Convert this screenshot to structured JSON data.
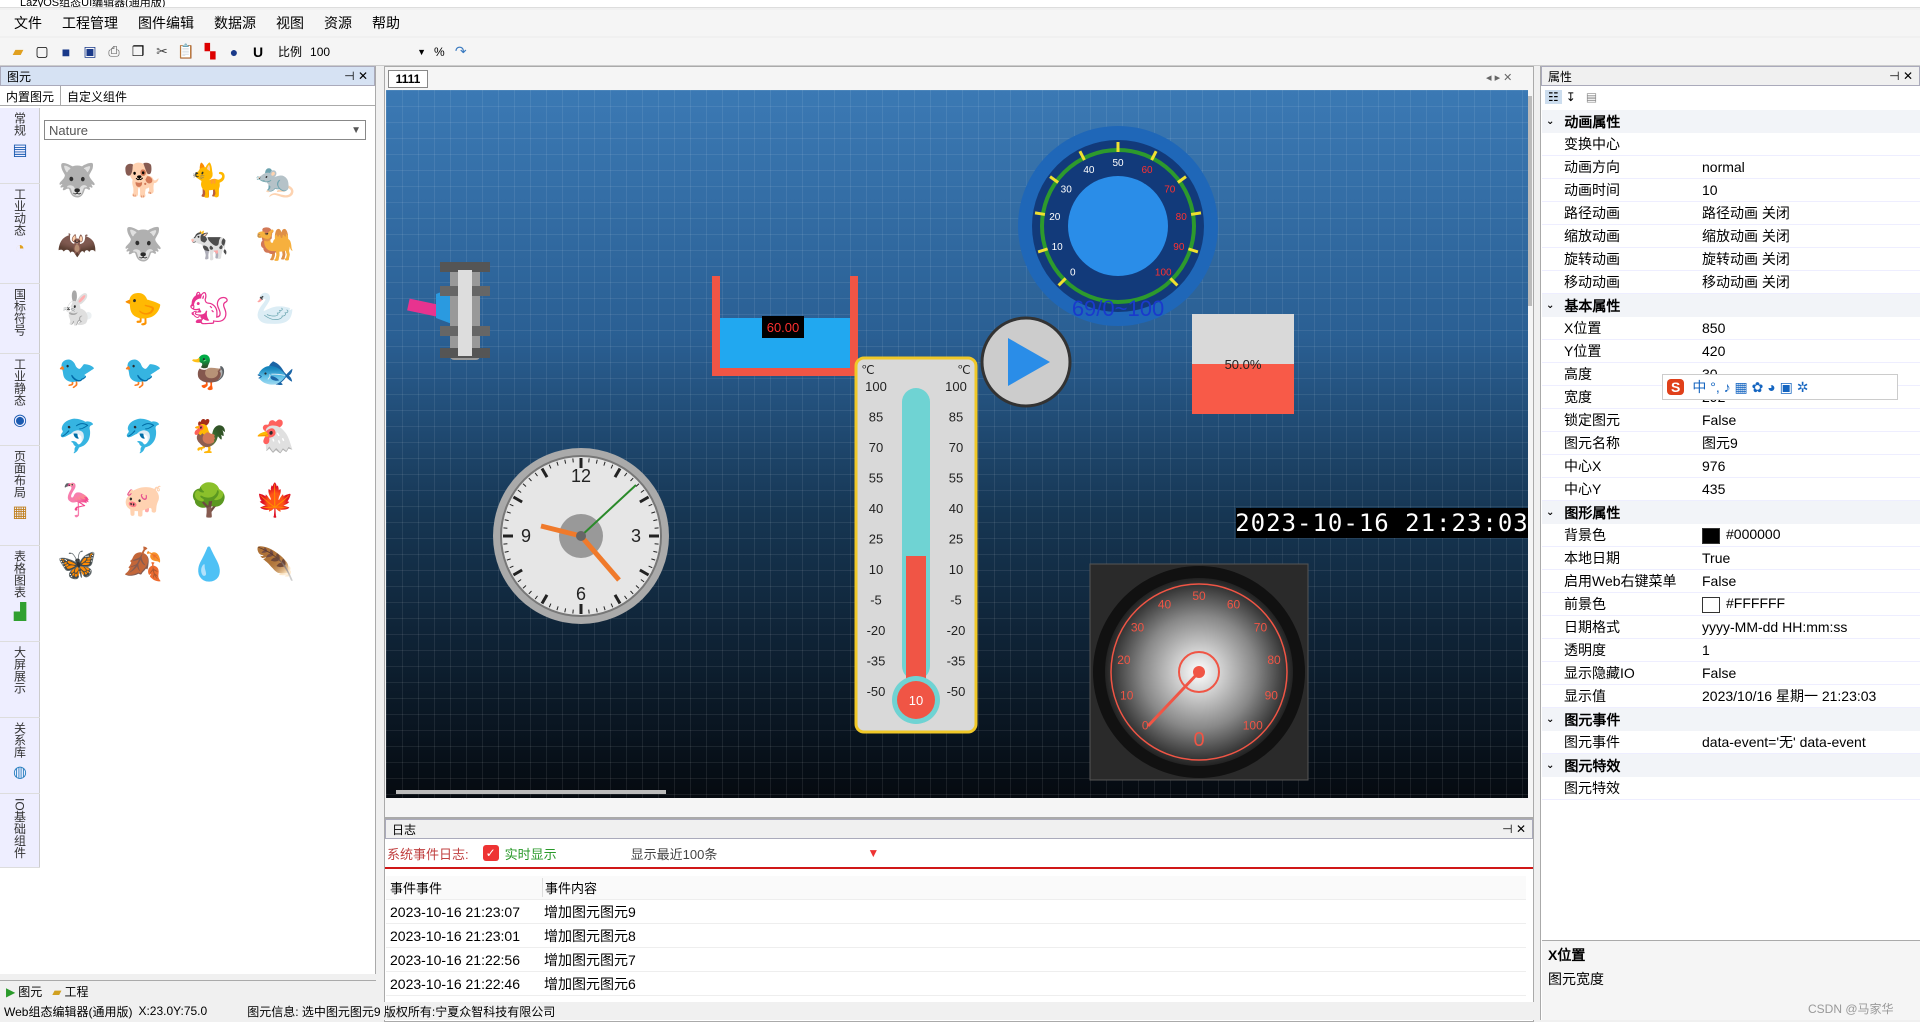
{
  "window": {
    "title": "LazyOS组态UI编辑器(通用版)"
  },
  "menu": [
    "文件",
    "工程管理",
    "图件编辑",
    "数据源",
    "视图",
    "资源",
    "帮助"
  ],
  "toolbar": {
    "scale_label": "比例",
    "scale_value": "100",
    "percent": "%"
  },
  "left_pane": {
    "title": "图元",
    "tabs": [
      "内置图元",
      "自定义组件"
    ],
    "categories": [
      "常规",
      "工业动态",
      "国标符号",
      "工业静态",
      "页面布局",
      "表格图表",
      "大屏展示",
      "关系库",
      "IO基础组件"
    ],
    "library_select": "Nature",
    "bottom_tabs": [
      "图元",
      "工程"
    ]
  },
  "library_icons": [
    "🐺",
    "🐕",
    "🐈",
    "🐀",
    "🦇",
    "🐺",
    "🐄",
    "🐫",
    "🐇",
    "🐤",
    "🐿",
    "🦢",
    "🐦",
    "🐦",
    "🦆",
    "🐟",
    "🐬",
    "🐬",
    "🐓",
    "🐔",
    "🦩",
    "🐖",
    "🌳",
    "🍁",
    "🦋",
    "🍂",
    "💧",
    "🪶"
  ],
  "library_colors": {
    "top": "#e8338f",
    "bottom": "#f07a2b"
  },
  "document": {
    "tab": "1111"
  },
  "canvas": {
    "tank_value": "60.00",
    "gauge_ticks": [
      "0",
      "10",
      "20",
      "30",
      "40",
      "50",
      "60",
      "70",
      "80",
      "90",
      "100"
    ],
    "gauge_readout": "69/0~100",
    "bar_percent": "50.0%",
    "bar_fill": 0.5,
    "thermo_unit": "℃",
    "thermo_scale": [
      "100",
      "85",
      "70",
      "55",
      "40",
      "25",
      "10",
      "-5",
      "-20",
      "-35",
      "-50"
    ],
    "thermo_value": "10",
    "clock_numbers": [
      "12",
      "3",
      "6",
      "9"
    ],
    "datetime": "2023-10-16 21:23:03",
    "speedo_ticks": [
      "0",
      "10",
      "20",
      "30",
      "40",
      "50",
      "60",
      "70",
      "80",
      "90",
      "100"
    ],
    "speedo_value": "0"
  },
  "log_pane": {
    "title": "日志",
    "label": "系统事件日志:",
    "realtime": "实时显示",
    "recent": "显示最近100条",
    "headers": [
      "事件事件",
      "事件内容"
    ],
    "rows": [
      [
        "2023-10-16 21:23:07",
        "增加图元图元9"
      ],
      [
        "2023-10-16 21:23:01",
        "增加图元图元8"
      ],
      [
        "2023-10-16 21:22:56",
        "增加图元图元7"
      ],
      [
        "2023-10-16 21:22:46",
        "增加图元图元6"
      ]
    ]
  },
  "props": {
    "title": "属性",
    "sections": [
      {
        "name": "动画属性",
        "rows": [
          [
            "变换中心",
            ""
          ],
          [
            "动画方向",
            "normal"
          ],
          [
            "动画时间",
            "10"
          ],
          [
            "路径动画",
            "路径动画 关闭"
          ],
          [
            "缩放动画",
            "缩放动画 关闭"
          ],
          [
            "旋转动画",
            "旋转动画 关闭"
          ],
          [
            "移动动画",
            "移动动画 关闭"
          ]
        ]
      },
      {
        "name": "基本属性",
        "rows": [
          [
            "X位置",
            "850"
          ],
          [
            "Y位置",
            "420"
          ],
          [
            "高度",
            "30"
          ],
          [
            "宽度",
            "292"
          ],
          [
            "锁定图元",
            "False"
          ],
          [
            "图元名称",
            "图元9"
          ],
          [
            "中心X",
            "976"
          ],
          [
            "中心Y",
            "435"
          ]
        ]
      },
      {
        "name": "图形属性",
        "rows": [
          [
            "背景色",
            "#000000"
          ],
          [
            "本地日期",
            "True"
          ],
          [
            "启用Web右键菜单",
            "False"
          ],
          [
            "前景色",
            "#FFFFFF"
          ],
          [
            "日期格式",
            "yyyy-MM-dd HH:mm:ss"
          ],
          [
            "透明度",
            "1"
          ],
          [
            "显示隐藏IO",
            "False"
          ],
          [
            "显示值",
            "2023/10/16 星期一 21:23:03"
          ]
        ]
      },
      {
        "name": "图元事件",
        "rows": [
          [
            "图元事件",
            " data-event='无'  data-event"
          ]
        ]
      },
      {
        "name": "图元特效",
        "rows": [
          [
            "图元特效",
            ""
          ]
        ]
      }
    ],
    "desc_title": "X位置",
    "desc_text": "图元宽度"
  },
  "status": {
    "app": "Web组态编辑器(通用版)",
    "coords": "X:23.0Y:75.0",
    "info": "图元信息:   选中图元图元9  版权所有:宁夏众智科技有限公司"
  },
  "watermark": "CSDN @马家华"
}
